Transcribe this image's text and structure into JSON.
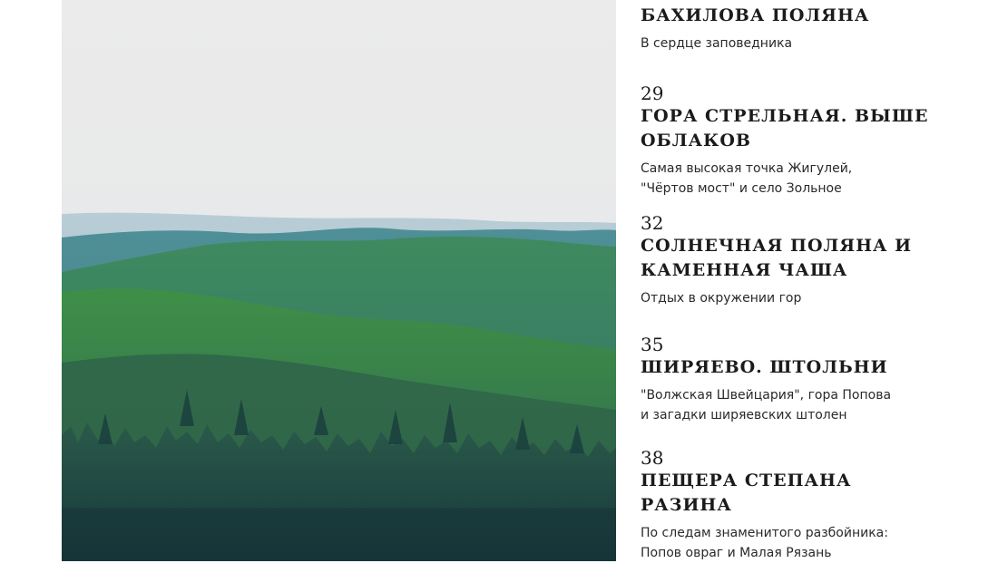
{
  "toc": [
    {
      "number": "",
      "title": "Бахилова поляна",
      "desc": "В сердце заповедника"
    },
    {
      "number": "29",
      "title": "Гора Стрельная. Выше облаков",
      "desc": "Самая высокая точка Жигулей,\n\"Чёртов мост\" и село Зольное"
    },
    {
      "number": "32",
      "title": "Солнечная поляна и каменная чаша",
      "desc": "Отдых в окружении гор"
    },
    {
      "number": "35",
      "title": "Ширяево. Штольни",
      "desc": "\"Волжская Швейцария\", гора Попова\nи загадки ширяевских штолен"
    },
    {
      "number": "38",
      "title": "Пещера Степана Разина",
      "desc": "По следам знаменитого разбойника:\nПопов овраг и Малая Рязань"
    }
  ],
  "photo": {
    "subject": "forest-hills-photo"
  }
}
